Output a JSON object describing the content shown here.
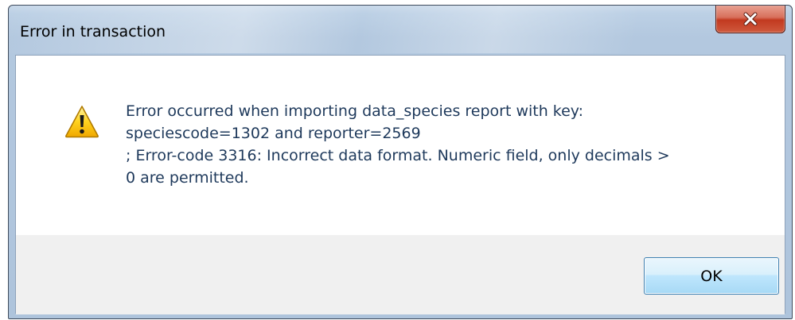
{
  "dialog": {
    "title": "Error in transaction",
    "message": "Error occurred when importing data_species report with key:\nspeciescode=1302 and reporter=2569\n; Error-code 3316: Incorrect data format. Numeric field, only decimals >\n0 are permitted.",
    "ok_label": "OK",
    "close_icon": "close-icon",
    "status_icon": "warning-icon"
  },
  "colors": {
    "message_text": "#1e395b",
    "close_button": "#c7412a",
    "ok_button_border": "#3c7fb1",
    "button_area": "#f0f0f0"
  }
}
